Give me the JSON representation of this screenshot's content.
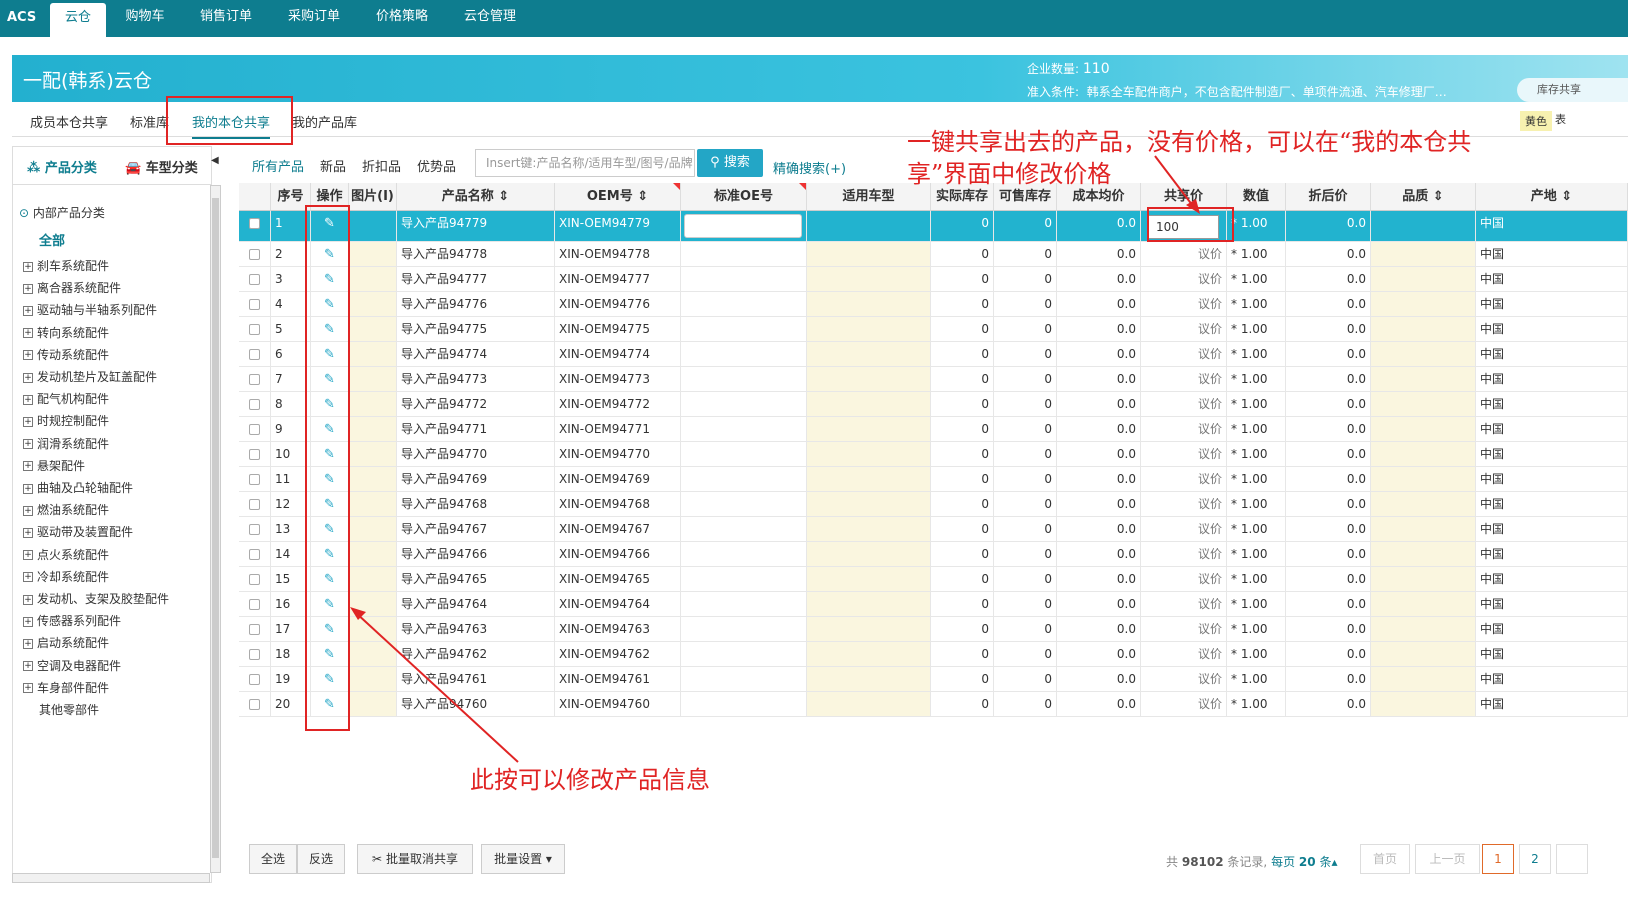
{
  "topnav": {
    "logo": "ACS",
    "items": [
      "云仓",
      "购物车",
      "销售订单",
      "采购订单",
      "价格策略",
      "云仓管理"
    ],
    "active_index": 0
  },
  "banner": {
    "title": "一配(韩系)云仓",
    "count_label": "企业数量:",
    "count_value": "110",
    "condition_label": "准入条件:",
    "condition_text": "韩系全车配件商户，不包含配件制造厂、单项件流通、汽车修理厂…",
    "stock_btn": "库存共享"
  },
  "subtabs": {
    "items": [
      "成员本仓共享",
      "标准库",
      "我的本仓共享",
      "我的产品库"
    ],
    "active_index": 2
  },
  "legend": {
    "yellow": "黄色",
    "extra": "表"
  },
  "left": {
    "tab1": "产品分类",
    "tab2": "车型分类",
    "root": "内部产品分类",
    "all": "全部",
    "items": [
      "刹车系统配件",
      "离合器系统配件",
      "驱动轴与半轴系列配件",
      "转向系统配件",
      "传动系统配件",
      "发动机垫片及缸盖配件",
      "配气机构配件",
      "时规控制配件",
      "润滑系统配件",
      "悬架配件",
      "曲轴及凸轮轴配件",
      "燃油系统配件",
      "驱动带及装置配件",
      "点火系统配件",
      "冷却系统配件",
      "发动机、支架及胶垫配件",
      "传感器系列配件",
      "启动系统配件",
      "空调及电器配件",
      "车身部件配件",
      "其他零部件"
    ]
  },
  "filters": {
    "items": [
      "所有产品",
      "新品",
      "折扣品",
      "优势品"
    ],
    "search_placeholder": "Insert键:产品名称/适用车型/图号/品牌",
    "search_btn": "搜索",
    "advanced": "精确搜索(+)"
  },
  "columns": [
    "序号",
    "操作",
    "图片(I)",
    "产品名称 ⇕",
    "OEM号 ⇕",
    "标准OE号",
    "适用车型",
    "实际库存",
    "可售库存",
    "成本均价",
    "共享价",
    "数值",
    "折后价",
    "品质 ⇕",
    "产地 ⇕"
  ],
  "rows": [
    {
      "no": "1",
      "name": "导入产品94779",
      "oem": "XIN-OEM94779",
      "stock": "0",
      "sellable": "0",
      "cost": "0.0",
      "price": "100",
      "qty": "* 1.00",
      "disc": "0.0",
      "origin": "中国"
    },
    {
      "no": "2",
      "name": "导入产品94778",
      "oem": "XIN-OEM94778",
      "stock": "0",
      "sellable": "0",
      "cost": "0.0",
      "price": "议价",
      "qty": "* 1.00",
      "disc": "0.0",
      "origin": "中国"
    },
    {
      "no": "3",
      "name": "导入产品94777",
      "oem": "XIN-OEM94777",
      "stock": "0",
      "sellable": "0",
      "cost": "0.0",
      "price": "议价",
      "qty": "* 1.00",
      "disc": "0.0",
      "origin": "中国"
    },
    {
      "no": "4",
      "name": "导入产品94776",
      "oem": "XIN-OEM94776",
      "stock": "0",
      "sellable": "0",
      "cost": "0.0",
      "price": "议价",
      "qty": "* 1.00",
      "disc": "0.0",
      "origin": "中国"
    },
    {
      "no": "5",
      "name": "导入产品94775",
      "oem": "XIN-OEM94775",
      "stock": "0",
      "sellable": "0",
      "cost": "0.0",
      "price": "议价",
      "qty": "* 1.00",
      "disc": "0.0",
      "origin": "中国"
    },
    {
      "no": "6",
      "name": "导入产品94774",
      "oem": "XIN-OEM94774",
      "stock": "0",
      "sellable": "0",
      "cost": "0.0",
      "price": "议价",
      "qty": "* 1.00",
      "disc": "0.0",
      "origin": "中国"
    },
    {
      "no": "7",
      "name": "导入产品94773",
      "oem": "XIN-OEM94773",
      "stock": "0",
      "sellable": "0",
      "cost": "0.0",
      "price": "议价",
      "qty": "* 1.00",
      "disc": "0.0",
      "origin": "中国"
    },
    {
      "no": "8",
      "name": "导入产品94772",
      "oem": "XIN-OEM94772",
      "stock": "0",
      "sellable": "0",
      "cost": "0.0",
      "price": "议价",
      "qty": "* 1.00",
      "disc": "0.0",
      "origin": "中国"
    },
    {
      "no": "9",
      "name": "导入产品94771",
      "oem": "XIN-OEM94771",
      "stock": "0",
      "sellable": "0",
      "cost": "0.0",
      "price": "议价",
      "qty": "* 1.00",
      "disc": "0.0",
      "origin": "中国"
    },
    {
      "no": "10",
      "name": "导入产品94770",
      "oem": "XIN-OEM94770",
      "stock": "0",
      "sellable": "0",
      "cost": "0.0",
      "price": "议价",
      "qty": "* 1.00",
      "disc": "0.0",
      "origin": "中国"
    },
    {
      "no": "11",
      "name": "导入产品94769",
      "oem": "XIN-OEM94769",
      "stock": "0",
      "sellable": "0",
      "cost": "0.0",
      "price": "议价",
      "qty": "* 1.00",
      "disc": "0.0",
      "origin": "中国"
    },
    {
      "no": "12",
      "name": "导入产品94768",
      "oem": "XIN-OEM94768",
      "stock": "0",
      "sellable": "0",
      "cost": "0.0",
      "price": "议价",
      "qty": "* 1.00",
      "disc": "0.0",
      "origin": "中国"
    },
    {
      "no": "13",
      "name": "导入产品94767",
      "oem": "XIN-OEM94767",
      "stock": "0",
      "sellable": "0",
      "cost": "0.0",
      "price": "议价",
      "qty": "* 1.00",
      "disc": "0.0",
      "origin": "中国"
    },
    {
      "no": "14",
      "name": "导入产品94766",
      "oem": "XIN-OEM94766",
      "stock": "0",
      "sellable": "0",
      "cost": "0.0",
      "price": "议价",
      "qty": "* 1.00",
      "disc": "0.0",
      "origin": "中国"
    },
    {
      "no": "15",
      "name": "导入产品94765",
      "oem": "XIN-OEM94765",
      "stock": "0",
      "sellable": "0",
      "cost": "0.0",
      "price": "议价",
      "qty": "* 1.00",
      "disc": "0.0",
      "origin": "中国"
    },
    {
      "no": "16",
      "name": "导入产品94764",
      "oem": "XIN-OEM94764",
      "stock": "0",
      "sellable": "0",
      "cost": "0.0",
      "price": "议价",
      "qty": "* 1.00",
      "disc": "0.0",
      "origin": "中国"
    },
    {
      "no": "17",
      "name": "导入产品94763",
      "oem": "XIN-OEM94763",
      "stock": "0",
      "sellable": "0",
      "cost": "0.0",
      "price": "议价",
      "qty": "* 1.00",
      "disc": "0.0",
      "origin": "中国"
    },
    {
      "no": "18",
      "name": "导入产品94762",
      "oem": "XIN-OEM94762",
      "stock": "0",
      "sellable": "0",
      "cost": "0.0",
      "price": "议价",
      "qty": "* 1.00",
      "disc": "0.0",
      "origin": "中国"
    },
    {
      "no": "19",
      "name": "导入产品94761",
      "oem": "XIN-OEM94761",
      "stock": "0",
      "sellable": "0",
      "cost": "0.0",
      "price": "议价",
      "qty": "* 1.00",
      "disc": "0.0",
      "origin": "中国"
    },
    {
      "no": "20",
      "name": "导入产品94760",
      "oem": "XIN-OEM94760",
      "stock": "0",
      "sellable": "0",
      "cost": "0.0",
      "price": "议价",
      "qty": "* 1.00",
      "disc": "0.0",
      "origin": "中国"
    }
  ],
  "bottom": {
    "select_all": "全选",
    "invert": "反选",
    "cancel_share": "批量取消共享",
    "batch": "批量设置",
    "total_prefix": "共",
    "total": "98102",
    "total_suffix": "条记录,",
    "per_page_label": "每页",
    "per_page": "20",
    "per_page_suffix": "条",
    "first": "首页",
    "prev": "上一页",
    "pages": [
      "1",
      "2"
    ]
  },
  "annotations": {
    "top": "一键共享出去的产品，没有价格，可以在“我的本仓共享”界面中修改价格",
    "bottom": "此按可以修改产品信息"
  },
  "colors": {
    "topbar": "#0e7d8f",
    "accent": "#23a6c6",
    "selected_row": "#22b3cf",
    "annotation": "#e02424"
  }
}
